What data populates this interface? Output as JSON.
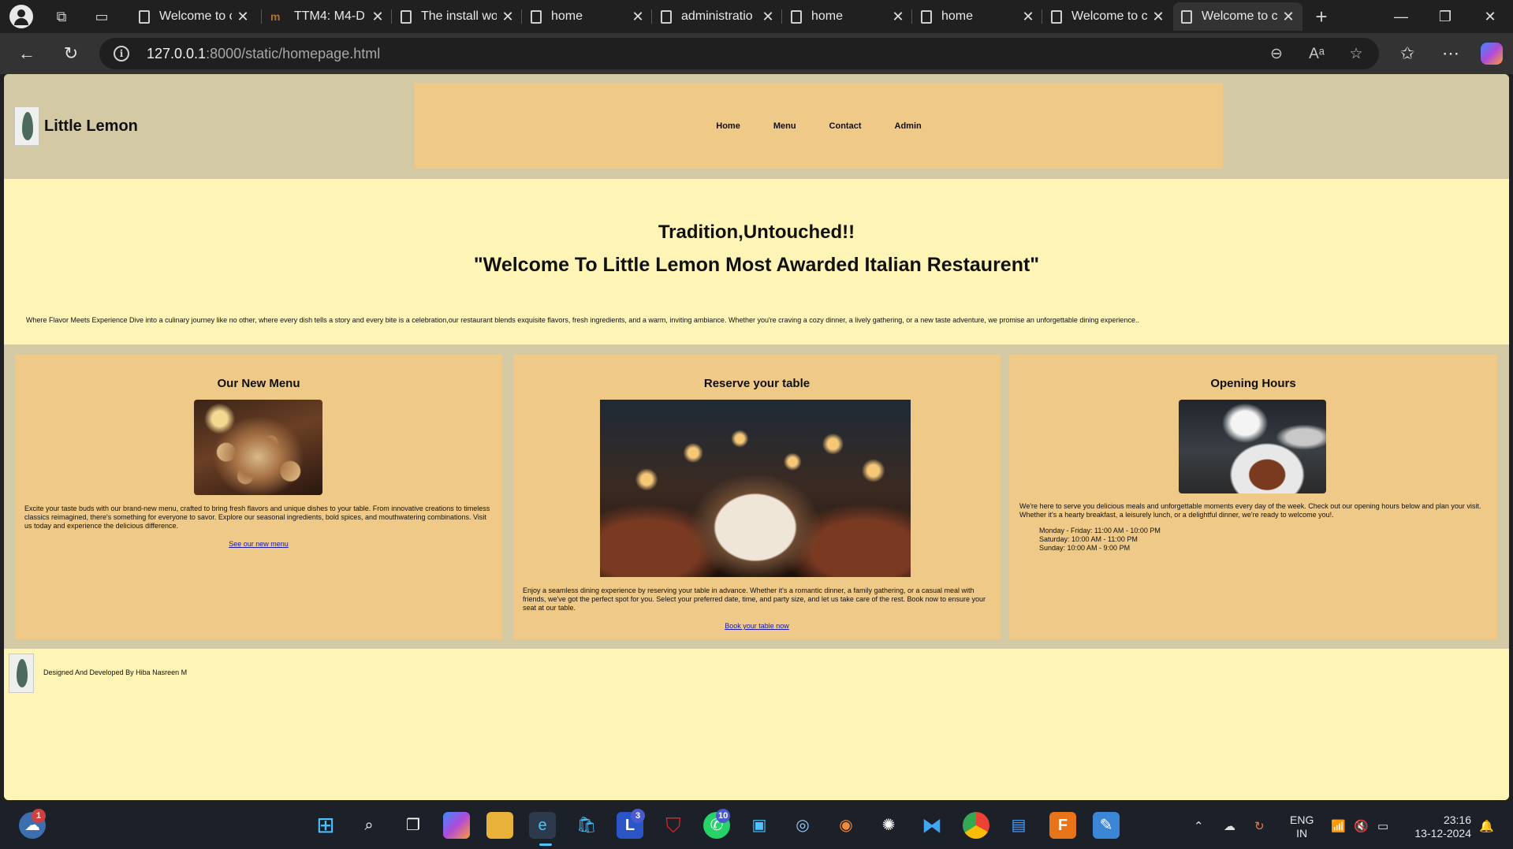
{
  "browser": {
    "tabs": [
      {
        "title": "Welcome to c",
        "icon": "page-icon"
      },
      {
        "title": "TTM4: M4-D",
        "icon": "moodle-icon"
      },
      {
        "title": "The install wo",
        "icon": "page-icon"
      },
      {
        "title": "home",
        "icon": "page-icon"
      },
      {
        "title": "administratio",
        "icon": "page-icon"
      },
      {
        "title": "home",
        "icon": "page-icon"
      },
      {
        "title": "home",
        "icon": "page-icon"
      },
      {
        "title": "Welcome to c",
        "icon": "page-icon"
      },
      {
        "title": "Welcome to c",
        "icon": "page-icon",
        "active": true
      }
    ],
    "url_host": "127.0.0.1",
    "url_path": ":8000/static/homepage.html"
  },
  "site": {
    "brand": "Little Lemon",
    "nav": [
      "Home",
      "Menu",
      "Contact",
      "Admin"
    ],
    "hero": {
      "heading": "Tradition,Untouched!!",
      "subheading": "\"Welcome To Little Lemon Most Awarded Italian Restaurent\"",
      "text": "Where Flavor Meets Experience Dive into a culinary journey like no other, where every dish tells a story and every bite is a celebration,our restaurant blends exquisite flavors, fresh ingredients, and a warm, inviting ambiance. Whether you're craving a cozy dinner, a lively gathering, or a new taste adventure, we promise an unforgettable dining experience.."
    },
    "cards": {
      "menu": {
        "title": "Our New Menu",
        "text": "Excite your taste buds with our brand-new menu, crafted to bring fresh flavors and unique dishes to your table. From innovative creations to timeless classics reimagined, there's something for everyone to savor. Explore our seasonal ingredients, bold spices, and mouthwatering combinations. Visit us today and experience the delicious difference.",
        "link": "See our new menu"
      },
      "reserve": {
        "title": "Reserve your table",
        "text": "Enjoy a seamless dining experience by reserving your table in advance. Whether it's a romantic dinner, a family gathering, or a casual meal with friends, we've got the perfect spot for you. Select your preferred date, time, and party size, and let us take care of the rest. Book now to ensure your seat at our table.",
        "link": "Book your table now"
      },
      "hours": {
        "title": "Opening Hours",
        "text": "We're here to serve you delicious meals and unforgettable moments every day of the week. Check out our opening hours below and plan your visit. Whether it's a hearty breakfast, a leisurely lunch, or a delightful dinner, we're ready to welcome you!.",
        "schedule": [
          "Monday - Friday: 11:00 AM - 10:00 PM",
          "Saturday: 10:00 AM - 11:00 PM",
          "Sunday: 10:00 AM - 9:00 PM"
        ]
      }
    },
    "footer": "Designed And Developed By Hiba Nasreen M"
  },
  "taskbar": {
    "weather_badge": "1",
    "teams_badge": "3",
    "whatsapp_badge": "10",
    "lang_line1": "ENG",
    "lang_line2": "IN",
    "time": "23:16",
    "date": "13-12-2024"
  }
}
